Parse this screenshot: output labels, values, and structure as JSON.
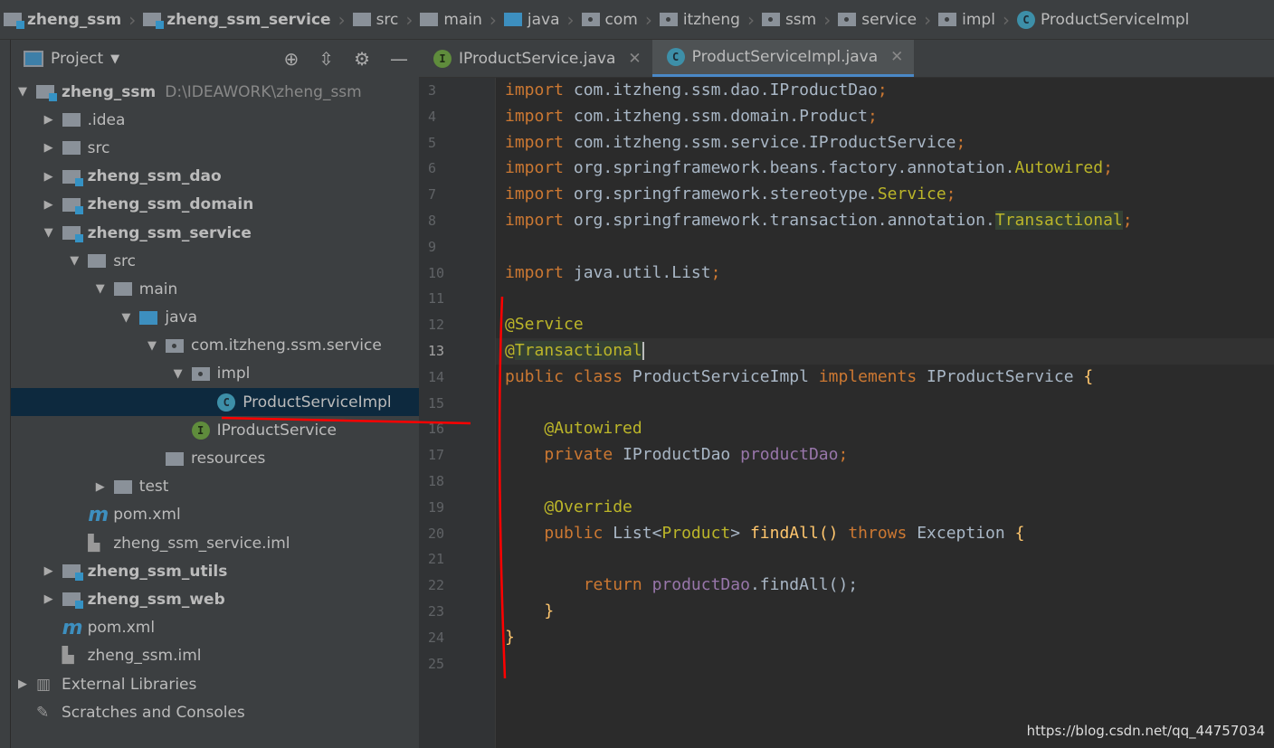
{
  "breadcrumb": [
    {
      "label": "zheng_ssm",
      "icon": "module-folder-icon",
      "bold": true
    },
    {
      "label": "zheng_ssm_service",
      "icon": "module-folder-icon",
      "bold": true
    },
    {
      "label": "src",
      "icon": "folder-icon"
    },
    {
      "label": "main",
      "icon": "folder-icon"
    },
    {
      "label": "java",
      "icon": "source-folder-icon"
    },
    {
      "label": "com",
      "icon": "package-icon"
    },
    {
      "label": "itzheng",
      "icon": "package-icon"
    },
    {
      "label": "ssm",
      "icon": "package-icon"
    },
    {
      "label": "service",
      "icon": "package-icon"
    },
    {
      "label": "impl",
      "icon": "package-icon"
    },
    {
      "label": "ProductServiceImpl",
      "icon": "class-icon"
    }
  ],
  "panel": {
    "title": "Project"
  },
  "tree": [
    {
      "label": "zheng_ssm",
      "path": "D:\\IDEAWORK\\zheng_ssm",
      "level": 0,
      "arrow": "down",
      "icon": "module",
      "bold": true
    },
    {
      "label": ".idea",
      "level": 1,
      "arrow": "right",
      "icon": "folder"
    },
    {
      "label": "src",
      "level": 1,
      "arrow": "right",
      "icon": "folder"
    },
    {
      "label": "zheng_ssm_dao",
      "level": 1,
      "arrow": "right",
      "icon": "module",
      "bold": true
    },
    {
      "label": "zheng_ssm_domain",
      "level": 1,
      "arrow": "right",
      "icon": "module",
      "bold": true
    },
    {
      "label": "zheng_ssm_service",
      "level": 1,
      "arrow": "down",
      "icon": "module",
      "bold": true
    },
    {
      "label": "src",
      "level": 2,
      "arrow": "down",
      "icon": "folder"
    },
    {
      "label": "main",
      "level": 3,
      "arrow": "down",
      "icon": "folder"
    },
    {
      "label": "java",
      "level": 4,
      "arrow": "down",
      "icon": "source"
    },
    {
      "label": "com.itzheng.ssm.service",
      "level": 5,
      "arrow": "down",
      "icon": "package"
    },
    {
      "label": "impl",
      "level": 6,
      "arrow": "down",
      "icon": "package"
    },
    {
      "label": "ProductServiceImpl",
      "level": 7,
      "arrow": "",
      "icon": "class",
      "selected": true
    },
    {
      "label": "IProductService",
      "level": 6,
      "arrow": "",
      "icon": "interface"
    },
    {
      "label": "resources",
      "level": 5,
      "arrow": "",
      "icon": "folder"
    },
    {
      "label": "test",
      "level": 3,
      "arrow": "right",
      "icon": "folder"
    },
    {
      "label": "pom.xml",
      "level": 2,
      "arrow": "",
      "icon": "maven"
    },
    {
      "label": "zheng_ssm_service.iml",
      "level": 2,
      "arrow": "",
      "icon": "file"
    },
    {
      "label": "zheng_ssm_utils",
      "level": 1,
      "arrow": "right",
      "icon": "module",
      "bold": true
    },
    {
      "label": "zheng_ssm_web",
      "level": 1,
      "arrow": "right",
      "icon": "module",
      "bold": true
    },
    {
      "label": "pom.xml",
      "level": 1,
      "arrow": "",
      "icon": "maven"
    },
    {
      "label": "zheng_ssm.iml",
      "level": 1,
      "arrow": "",
      "icon": "file"
    },
    {
      "label": "External Libraries",
      "level": 0,
      "arrow": "right",
      "icon": "library"
    },
    {
      "label": "Scratches and Consoles",
      "level": 0,
      "arrow": "",
      "icon": "scratch"
    }
  ],
  "tabs": [
    {
      "label": "IProductService.java",
      "icon": "interface-icon",
      "active": false
    },
    {
      "label": "ProductServiceImpl.java",
      "icon": "class-icon",
      "active": true
    }
  ],
  "current_line": 13,
  "code": [
    {
      "n": "3",
      "t": [
        [
          "import ",
          "k"
        ],
        [
          "com.itzheng.ssm.dao.IProductDao",
          ""
        ],
        [
          ";",
          "k"
        ]
      ]
    },
    {
      "n": "4",
      "t": [
        [
          "import ",
          "k"
        ],
        [
          "com.itzheng.ssm.domain.Product",
          ""
        ],
        [
          ";",
          "k"
        ]
      ]
    },
    {
      "n": "5",
      "t": [
        [
          "import ",
          "k"
        ],
        [
          "com.itzheng.ssm.service.IProductService",
          ""
        ],
        [
          ";",
          "k"
        ]
      ]
    },
    {
      "n": "6",
      "t": [
        [
          "import ",
          "k"
        ],
        [
          "org.springframework.beans.factory.annotation.",
          ""
        ],
        [
          "Autowired",
          "a"
        ],
        [
          ";",
          "k"
        ]
      ]
    },
    {
      "n": "7",
      "t": [
        [
          "import ",
          "k"
        ],
        [
          "org.springframework.stereotype.",
          ""
        ],
        [
          "Service",
          "a"
        ],
        [
          ";",
          "k"
        ]
      ]
    },
    {
      "n": "8",
      "t": [
        [
          "import ",
          "k"
        ],
        [
          "org.springframework.transaction.annotation.",
          ""
        ],
        [
          "Transactional",
          "a hl"
        ],
        [
          ";",
          "k"
        ]
      ]
    },
    {
      "n": "9",
      "t": []
    },
    {
      "n": "10",
      "t": [
        [
          "import ",
          "k"
        ],
        [
          "java.util.List",
          ""
        ],
        [
          ";",
          "k"
        ]
      ]
    },
    {
      "n": "11",
      "t": []
    },
    {
      "n": "12",
      "t": [
        [
          "@Service",
          "a"
        ]
      ]
    },
    {
      "n": "13",
      "t": [
        [
          "@",
          "a"
        ],
        [
          "Transactional",
          "a hl"
        ]
      ]
    },
    {
      "n": "14",
      "t": [
        [
          "public class ",
          "k"
        ],
        [
          "ProductServiceImpl ",
          ""
        ],
        [
          "implements ",
          "k"
        ],
        [
          "IProductService ",
          ""
        ],
        [
          "{",
          "m"
        ]
      ]
    },
    {
      "n": "15",
      "t": []
    },
    {
      "n": "16",
      "t": [
        [
          "    ",
          ""
        ],
        [
          "@Autowired",
          "a"
        ]
      ]
    },
    {
      "n": "17",
      "t": [
        [
          "    ",
          ""
        ],
        [
          "private ",
          "k"
        ],
        [
          "IProductDao ",
          ""
        ],
        [
          "productDao",
          "f"
        ],
        [
          ";",
          "k"
        ]
      ]
    },
    {
      "n": "18",
      "t": []
    },
    {
      "n": "19",
      "t": [
        [
          "    ",
          ""
        ],
        [
          "@Override",
          "a"
        ]
      ]
    },
    {
      "n": "20",
      "t": [
        [
          "    ",
          ""
        ],
        [
          "public ",
          "k"
        ],
        [
          "List<",
          ""
        ],
        [
          "Product",
          "a"
        ],
        [
          "> ",
          ""
        ],
        [
          "findAll",
          "m"
        ],
        [
          "() ",
          "m"
        ],
        [
          "throws ",
          "k"
        ],
        [
          "Exception ",
          ""
        ],
        [
          "{",
          "m"
        ]
      ]
    },
    {
      "n": "21",
      "t": []
    },
    {
      "n": "22",
      "t": [
        [
          "        ",
          ""
        ],
        [
          "return ",
          "k"
        ],
        [
          "productDao",
          "f"
        ],
        [
          ".findAll();",
          ""
        ]
      ]
    },
    {
      "n": "23",
      "t": [
        [
          "    ",
          ""
        ],
        [
          "}",
          "m"
        ]
      ]
    },
    {
      "n": "24",
      "t": [
        [
          "}",
          "m"
        ]
      ]
    },
    {
      "n": "25",
      "t": []
    }
  ],
  "watermark": "https://blog.csdn.net/qq_44757034",
  "colors": {
    "keyword": "#cc7832",
    "annotation": "#bbb529",
    "field": "#9876aa",
    "method": "#ffc66d",
    "text": "#a9b7c6",
    "selection": "#0d293e",
    "pen": "#ff0000"
  }
}
